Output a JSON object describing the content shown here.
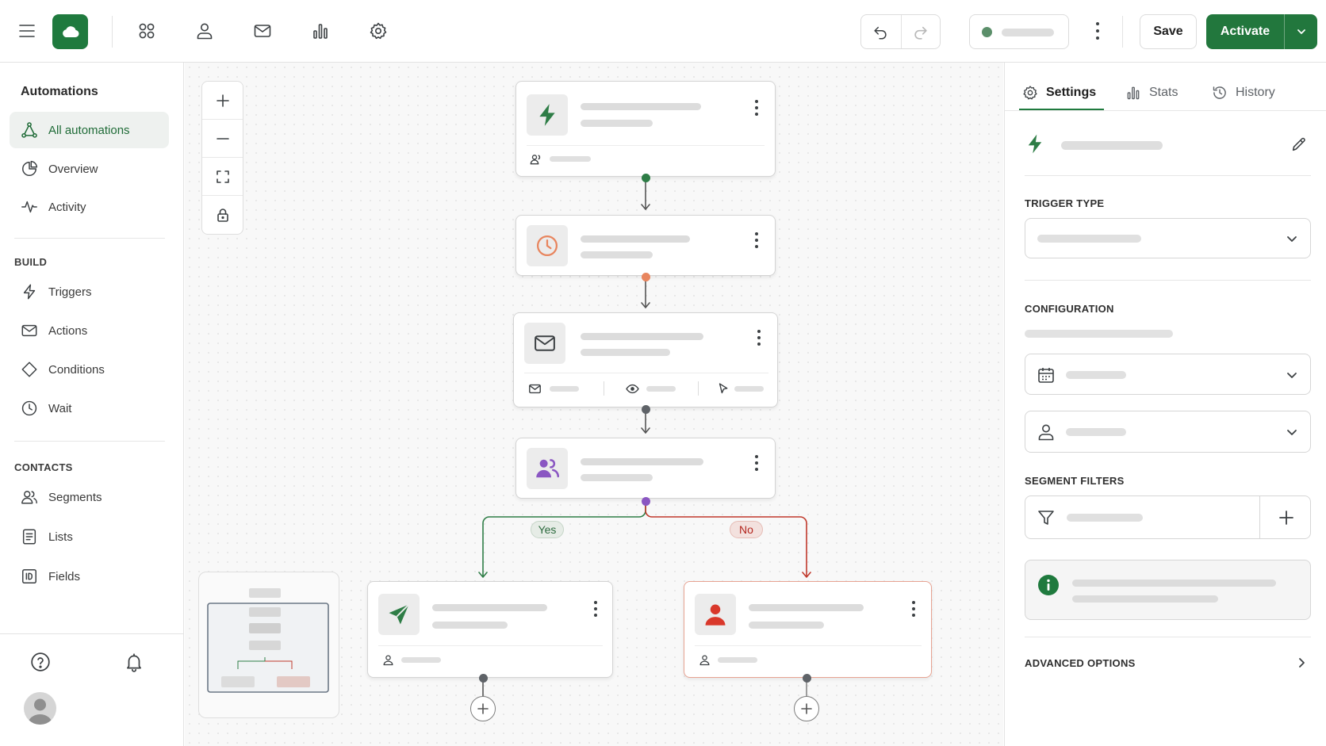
{
  "topbar": {
    "save_label": "Save",
    "activate_label": "Activate",
    "icons": [
      "menu-icon",
      "cloud-logo",
      "apps-grid-icon",
      "user-icon",
      "mail-icon",
      "chart-icon",
      "gear-icon",
      "undo-icon",
      "redo-icon",
      "more-vertical-icon",
      "chevron-down-icon"
    ],
    "status_color": "#5b8f6a",
    "brand_color": "#1f7a3e"
  },
  "sidebar": {
    "title": "Automations",
    "items": [
      {
        "label": "All automations",
        "icon": "workflow-icon",
        "active": true
      },
      {
        "label": "Overview",
        "icon": "pie-chart-icon"
      },
      {
        "label": "Activity",
        "icon": "activity-icon"
      }
    ],
    "build": {
      "title": "BUILD",
      "items": [
        {
          "label": "Triggers",
          "icon": "lightning-icon"
        },
        {
          "label": "Actions",
          "icon": "mail-icon"
        },
        {
          "label": "Conditions",
          "icon": "diamond-icon"
        },
        {
          "label": "Wait",
          "icon": "clock-icon"
        }
      ]
    },
    "contacts": {
      "title": "CONTACTS",
      "items": [
        {
          "label": "Segments",
          "icon": "users-icon"
        },
        {
          "label": "Lists",
          "icon": "list-icon"
        },
        {
          "label": "Fields",
          "icon": "id-field-icon"
        }
      ]
    }
  },
  "canvas": {
    "branch_yes": "Yes",
    "branch_no": "No",
    "colors": {
      "trigger": "#2e7d46",
      "wait": "#e8855e",
      "segment": "#8a56c2",
      "no_branch": "#c0392b",
      "yes_branch": "#2e7d46"
    }
  },
  "panel": {
    "tabs": [
      {
        "label": "Settings",
        "icon": "gear-icon",
        "active": true
      },
      {
        "label": "Stats",
        "icon": "bar-chart-icon"
      },
      {
        "label": "History",
        "icon": "history-icon"
      }
    ],
    "trigger_type_label": "TRIGGER TYPE",
    "configuration_label": "CONFIGURATION",
    "segment_filters_label": "SEGMENT FILTERS",
    "advanced_options_label": "ADVANCED OPTIONS"
  }
}
